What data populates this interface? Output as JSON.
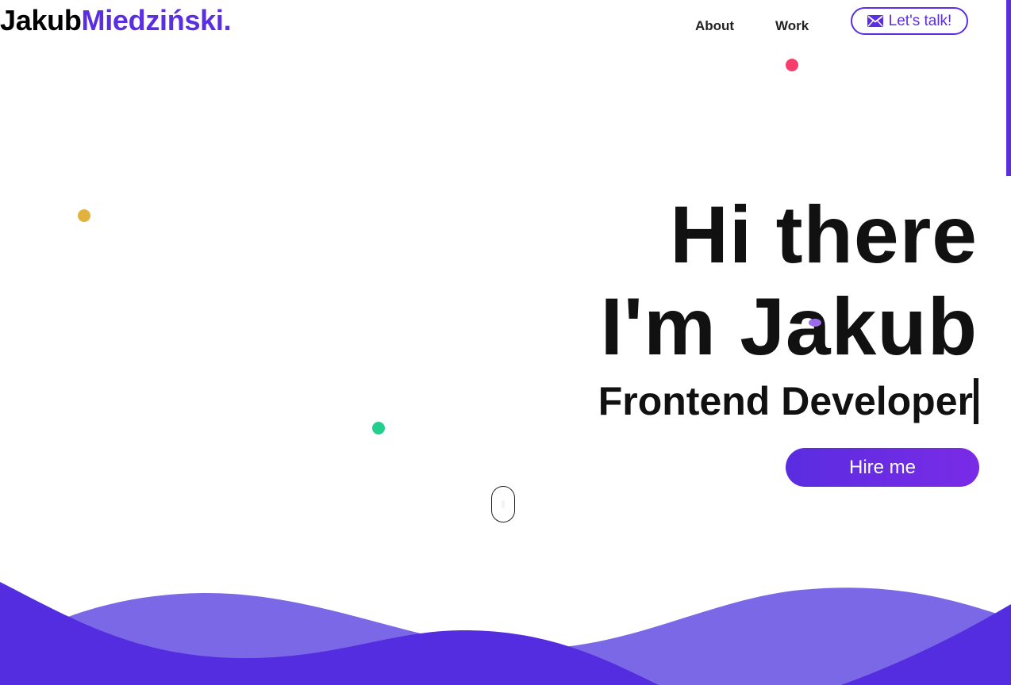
{
  "logo": {
    "first": "Jakub",
    "last": "Miedziński."
  },
  "nav": {
    "about": "About",
    "work": "Work",
    "talk_label": "Let's talk!",
    "talk_icon": "envelope-icon"
  },
  "hero": {
    "line1": "Hi there",
    "line2": "I'm Jakub",
    "role": "Frontend Developer",
    "cta": "Hire me"
  },
  "colors": {
    "accent": "#5b2ee1",
    "wave_back": "#7b68e6",
    "wave_front": "#552de0",
    "dot_red": "#f63d6b",
    "dot_yellow": "#e2b23e",
    "dot_green": "#22cf8c",
    "dot_purple": "#9a6ce8"
  },
  "icons": {
    "scroll": "mouse-scroll-icon"
  }
}
